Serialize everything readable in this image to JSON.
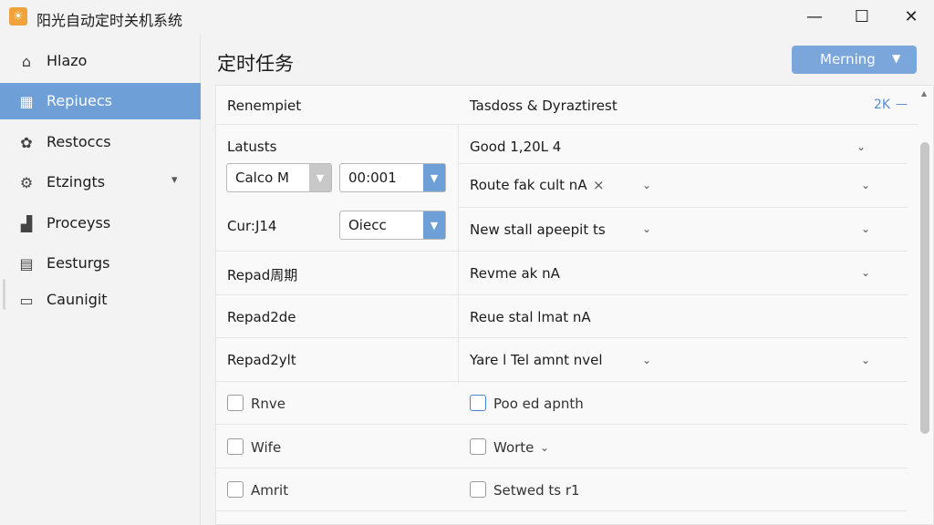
{
  "window": {
    "title": "阳光自动定时关机系统",
    "app_icon": "sun-icon",
    "controls": {
      "minimize": "—",
      "maximize": "☐",
      "close": "✕"
    }
  },
  "sidebar": {
    "items": [
      {
        "label": "Hlazo",
        "icon": "home-icon"
      },
      {
        "label": "Repiuecs",
        "icon": "grid-icon"
      },
      {
        "label": "Restoccs",
        "icon": "refresh-icon"
      },
      {
        "label": "Etzingts",
        "icon": "gear-icon"
      },
      {
        "label": "Proceyss",
        "icon": "process-icon"
      },
      {
        "label": "Eesturgs",
        "icon": "document-icon"
      },
      {
        "label": "Caunigit",
        "icon": "calendar-icon"
      }
    ]
  },
  "main": {
    "title": "定时任务",
    "top_dropdown": "Merning"
  },
  "form": {
    "header_left": "Renempiet",
    "header_right": "Tasdoss & Dyraztirest",
    "header_badge": "2K",
    "header_badge_suffix": "—",
    "labels": {
      "latusts": "Latusts",
      "cun": "Cur:J14",
      "repad1": "Repad周期",
      "repad2": "Repad2de",
      "repad3": "Repad2ylt"
    },
    "combo_calc": "Calco M",
    "combo_time": "00:001",
    "combo_oiec": "Oiecc",
    "right": {
      "row1": "Good 1,20L 4",
      "row2": "Route fak cult nA",
      "row2_close": "×",
      "row3": "New stall apeepit ts",
      "row4": "Revme ak nA",
      "row5": "Reue stal lmat nA",
      "row6": "Yare l Tel amnt nvel"
    },
    "checkboxes_left": [
      "Rnve",
      "Wife",
      "Amrit"
    ],
    "checkboxes_right": [
      "Poo ed apnth",
      "Worte",
      "Setwed ts r1"
    ]
  },
  "colors": {
    "accent": "#6e9fd6",
    "window_bg": "#f3f3f3",
    "panel_bg": "#f9f9f9"
  }
}
